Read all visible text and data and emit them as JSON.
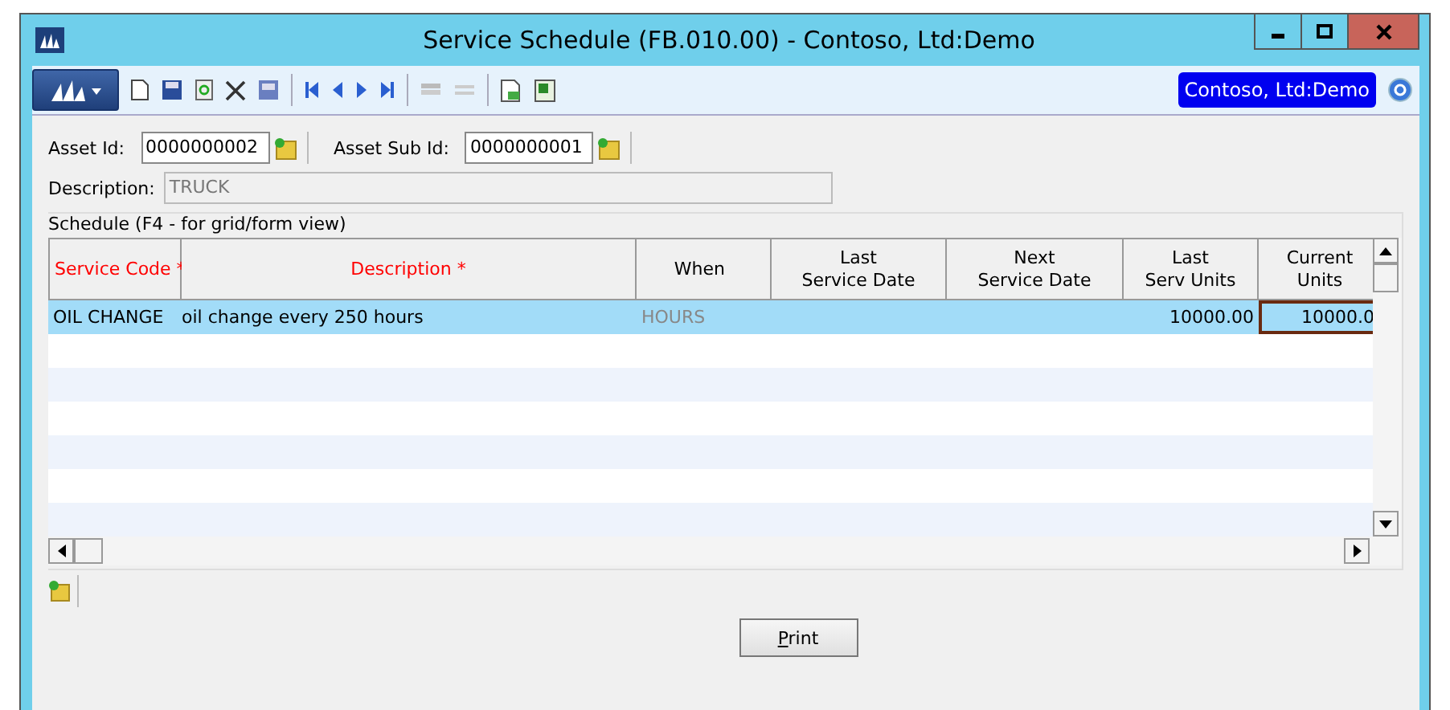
{
  "window": {
    "title": "Service Schedule (FB.010.00) - Contoso, Ltd:Demo"
  },
  "toolbar": {
    "company": "Contoso, Ltd:Demo"
  },
  "fields": [
    {
      "label": "Asset Id:",
      "value": "0000000002"
    },
    {
      "label": "Asset Sub Id:",
      "value": "0000000001"
    }
  ],
  "description": {
    "label": "Description:",
    "value": "TRUCK"
  },
  "schedule": {
    "title": "Schedule (F4 - for grid/form view)",
    "columns": [
      {
        "label": "Service Code *",
        "required": true
      },
      {
        "label": "Description *",
        "required": true
      },
      {
        "label": "When",
        "required": false
      },
      {
        "label": "Last\nService Date",
        "required": false
      },
      {
        "label": "Next\nService Date",
        "required": false
      },
      {
        "label": "Last\nServ Units",
        "required": false
      },
      {
        "label": "Current\nUnits",
        "required": false
      }
    ],
    "rows": [
      {
        "selected": true,
        "cells": [
          "OIL CHANGE",
          "oil change every 250 hours",
          "HOURS",
          "",
          "",
          "10000.00",
          "10000.0"
        ]
      }
    ]
  },
  "print": {
    "label": "Print"
  }
}
